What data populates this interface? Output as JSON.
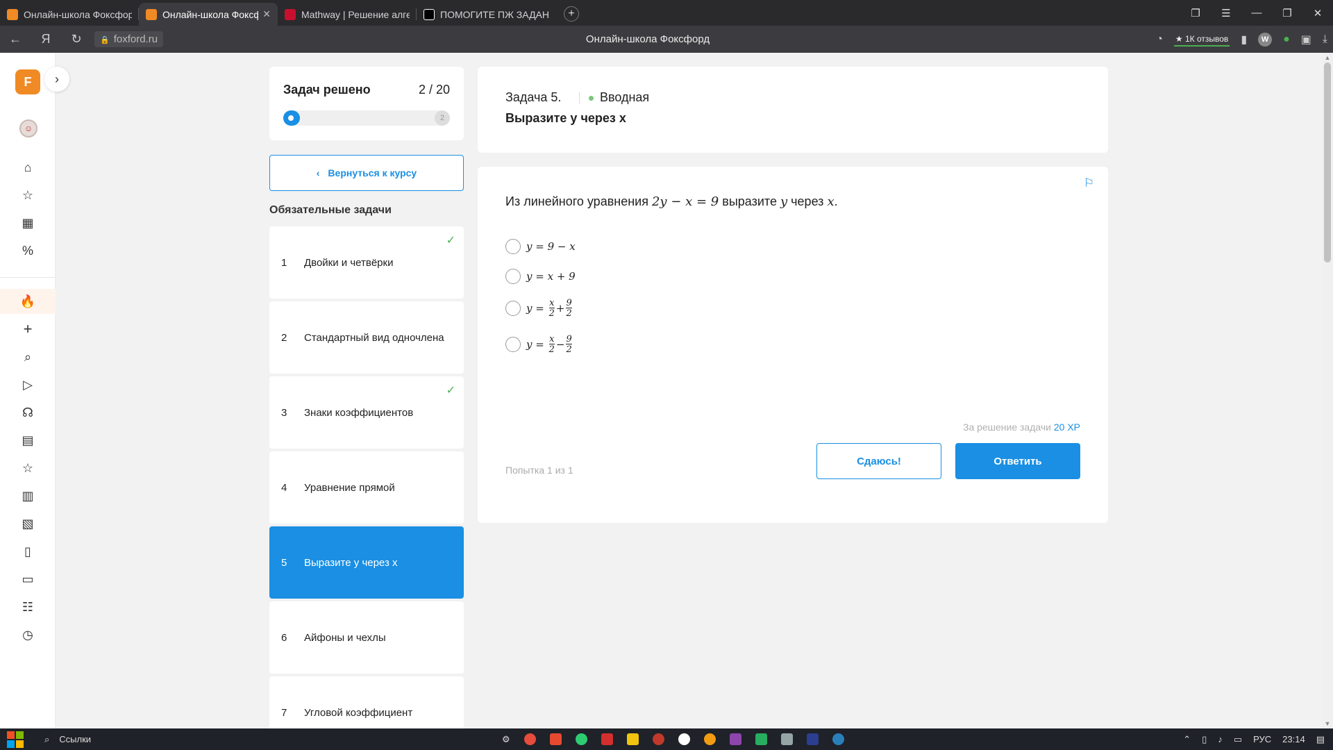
{
  "browser": {
    "tabs": [
      {
        "title": "Онлайн-школа Фоксфор",
        "color": "#f08a24",
        "active": false
      },
      {
        "title": "Онлайн-школа Фоксф",
        "color": "#f08a24",
        "active": true
      },
      {
        "title": "Mathway | Решение алгеб",
        "color": "#c8102e",
        "active": false
      },
      {
        "title": "ПОМОГИТЕ ПЖ ЗАДАНИ",
        "color": "#000000",
        "active": false
      }
    ],
    "close_glyph": "✕",
    "new_tab_glyph": "+",
    "url": "foxford.ru",
    "page_title": "Онлайн-школа Фоксфорд",
    "reviews": "★ 1К отзывов",
    "profile_letter": "W"
  },
  "sidebar": {
    "logo_letter": "F"
  },
  "progress": {
    "title": "Задач решено",
    "count": "2 / 20",
    "end_number": "2",
    "solved": 2,
    "total": 20
  },
  "back_button": {
    "label": "Вернуться к курсу"
  },
  "section_title": "Обязательные задачи",
  "tasks": [
    {
      "num": "1",
      "title": "Двойки и четвёрки",
      "done": true,
      "active": false
    },
    {
      "num": "2",
      "title": "Стандартный вид одночлена",
      "done": false,
      "active": false
    },
    {
      "num": "3",
      "title": "Знаки коэффициентов",
      "done": true,
      "active": false
    },
    {
      "num": "4",
      "title": "Уравнение прямой",
      "done": false,
      "active": false
    },
    {
      "num": "5",
      "title": "Выразите y через x",
      "done": false,
      "active": true
    },
    {
      "num": "6",
      "title": "Айфоны и чехлы",
      "done": false,
      "active": false
    },
    {
      "num": "7",
      "title": "Угловой коэффициент",
      "done": false,
      "active": false
    }
  ],
  "task_header": {
    "label": "Задача 5.",
    "type": "Вводная",
    "title": "Выразите y через x"
  },
  "question": {
    "prefix": "Из линейного уравнения",
    "equation": "2y − x = 9",
    "middle": "выразите",
    "var_y": "y",
    "through": "через",
    "var_x": "x",
    "end": "."
  },
  "options": [
    {
      "lhs": "y =",
      "text": "9 − x"
    },
    {
      "lhs": "y =",
      "text": "x + 9"
    },
    {
      "lhs": "y =",
      "a_num": "x",
      "a_den": "2",
      "op": "+",
      "b_num": "9",
      "b_den": "2"
    },
    {
      "lhs": "y =",
      "a_num": "x",
      "a_den": "2",
      "op": "−",
      "b_num": "9",
      "b_den": "2"
    }
  ],
  "reward": {
    "label": "За решение задачи",
    "value": "20 XP"
  },
  "attempt": "Попытка 1 из 1",
  "buttons": {
    "give_up": "Сдаюсь!",
    "answer": "Ответить"
  },
  "taskbar": {
    "search_label": "Ссылки",
    "lang": "РУС",
    "time": "23:14"
  },
  "colors": {
    "accent": "#1a8fe3",
    "success": "#4caf50"
  }
}
